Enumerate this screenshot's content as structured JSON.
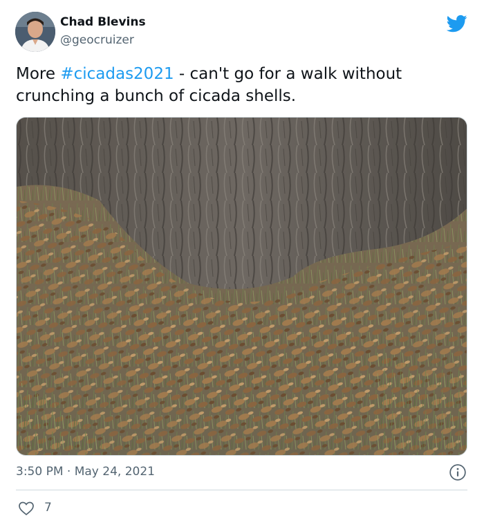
{
  "author": {
    "name": "Chad Blevins",
    "handle": "@geocruizer"
  },
  "tweet": {
    "text_before": "More ",
    "hashtag": "#cicadas2021",
    "text_after": " - can't go for a walk without crunching a bunch of cicada shells."
  },
  "media": {
    "alt": "Tree trunk base with ground covered in hundreds of cicada shells among grass"
  },
  "meta": {
    "time": "3:50 PM",
    "separator": "·",
    "date": "May 24, 2021"
  },
  "engagement": {
    "likes": "7"
  },
  "icons": {
    "brand": "twitter-bird-icon",
    "info": "info-icon",
    "like": "heart-icon"
  },
  "colors": {
    "brand": "#1d9bf0",
    "text": "#0f1419",
    "muted": "#536471",
    "border": "#cfd9de"
  }
}
